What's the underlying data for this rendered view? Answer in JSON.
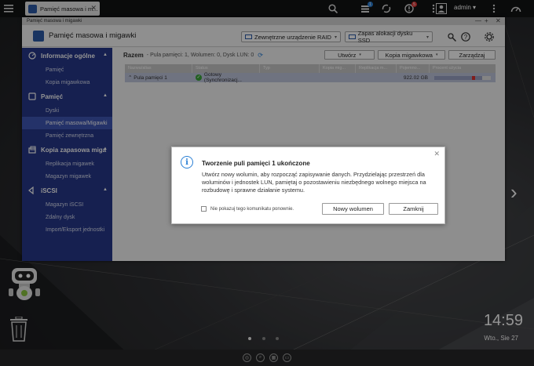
{
  "taskbar": {
    "tab_title": "Pamięć masowa i m...",
    "user": "admin",
    "badges": {
      "tasks": "1",
      "notifications": "5"
    }
  },
  "window": {
    "title": "Pamięć masowa i migawki",
    "app_title": "Pamięć masowa i migawki",
    "btn_external_raid": "Zewnętrzne urządzenie RAID",
    "btn_ssd_cache": "Zapas alokacji dysku SSD"
  },
  "sidebar": {
    "groups": [
      {
        "label": "Informacje ogólne",
        "items": [
          "Pamięć",
          "Kopia migawkowa"
        ]
      },
      {
        "label": "Pamięć",
        "items": [
          "Dyski",
          "Pamięć masowa/Migawki",
          "Pamięć zewnętrzna"
        ]
      },
      {
        "label": "Kopia zapasowa miga",
        "items": [
          "Replikacja migawek",
          "Magazyn migawek"
        ]
      },
      {
        "label": "iSCSI",
        "items": [
          "Magazyn iSCSI",
          "Zdalny dysk",
          "Import/Eksport jednostki"
        ]
      }
    ]
  },
  "main": {
    "summary_label": "Razem",
    "summary_text": "- Pula pamięci: 1, Wolumen: 0, Dysk LUN: 0",
    "btn_create": "Utwórz",
    "btn_snapshot": "Kopia migawkowa",
    "btn_manage": "Zarządzaj",
    "columns": [
      "Nazwa/alias",
      "Status",
      "Typ",
      "Kopia mig...",
      "Replikacja m...",
      "Pojemno...",
      "Procent użycia"
    ],
    "rows": [
      {
        "name": "Pula pamięci 1",
        "status": "Gotowy (Synchronizacj...",
        "type": "",
        "capacity": "922.02 GB",
        "usage_fraction": 0.85
      }
    ]
  },
  "dialog": {
    "title": "Tworzenie puli pamięci 1 ukończone",
    "body": "Utwórz nowy wolumin, aby rozpocząć zapisywanie danych. Przydzielając przestrzeń dla woluminów i jednostek LUN, pamiętaj o pozostawieniu niezbędnego wolnego miejsca na rozbudowę i sprawne działanie systemu.",
    "checkbox_label": "Nie pokazuj tego komunikatu ponownie.",
    "btn_new_volume": "Nowy wolumen",
    "btn_close": "Zamknij"
  },
  "desktop": {
    "time": "14:59",
    "date": "Wto., Sie 27"
  },
  "colors": {
    "sidebar": "#27378a",
    "sidebar_active": "#3f56b5",
    "info_blue": "#2a7fd4",
    "status_green": "#3aa53a"
  }
}
